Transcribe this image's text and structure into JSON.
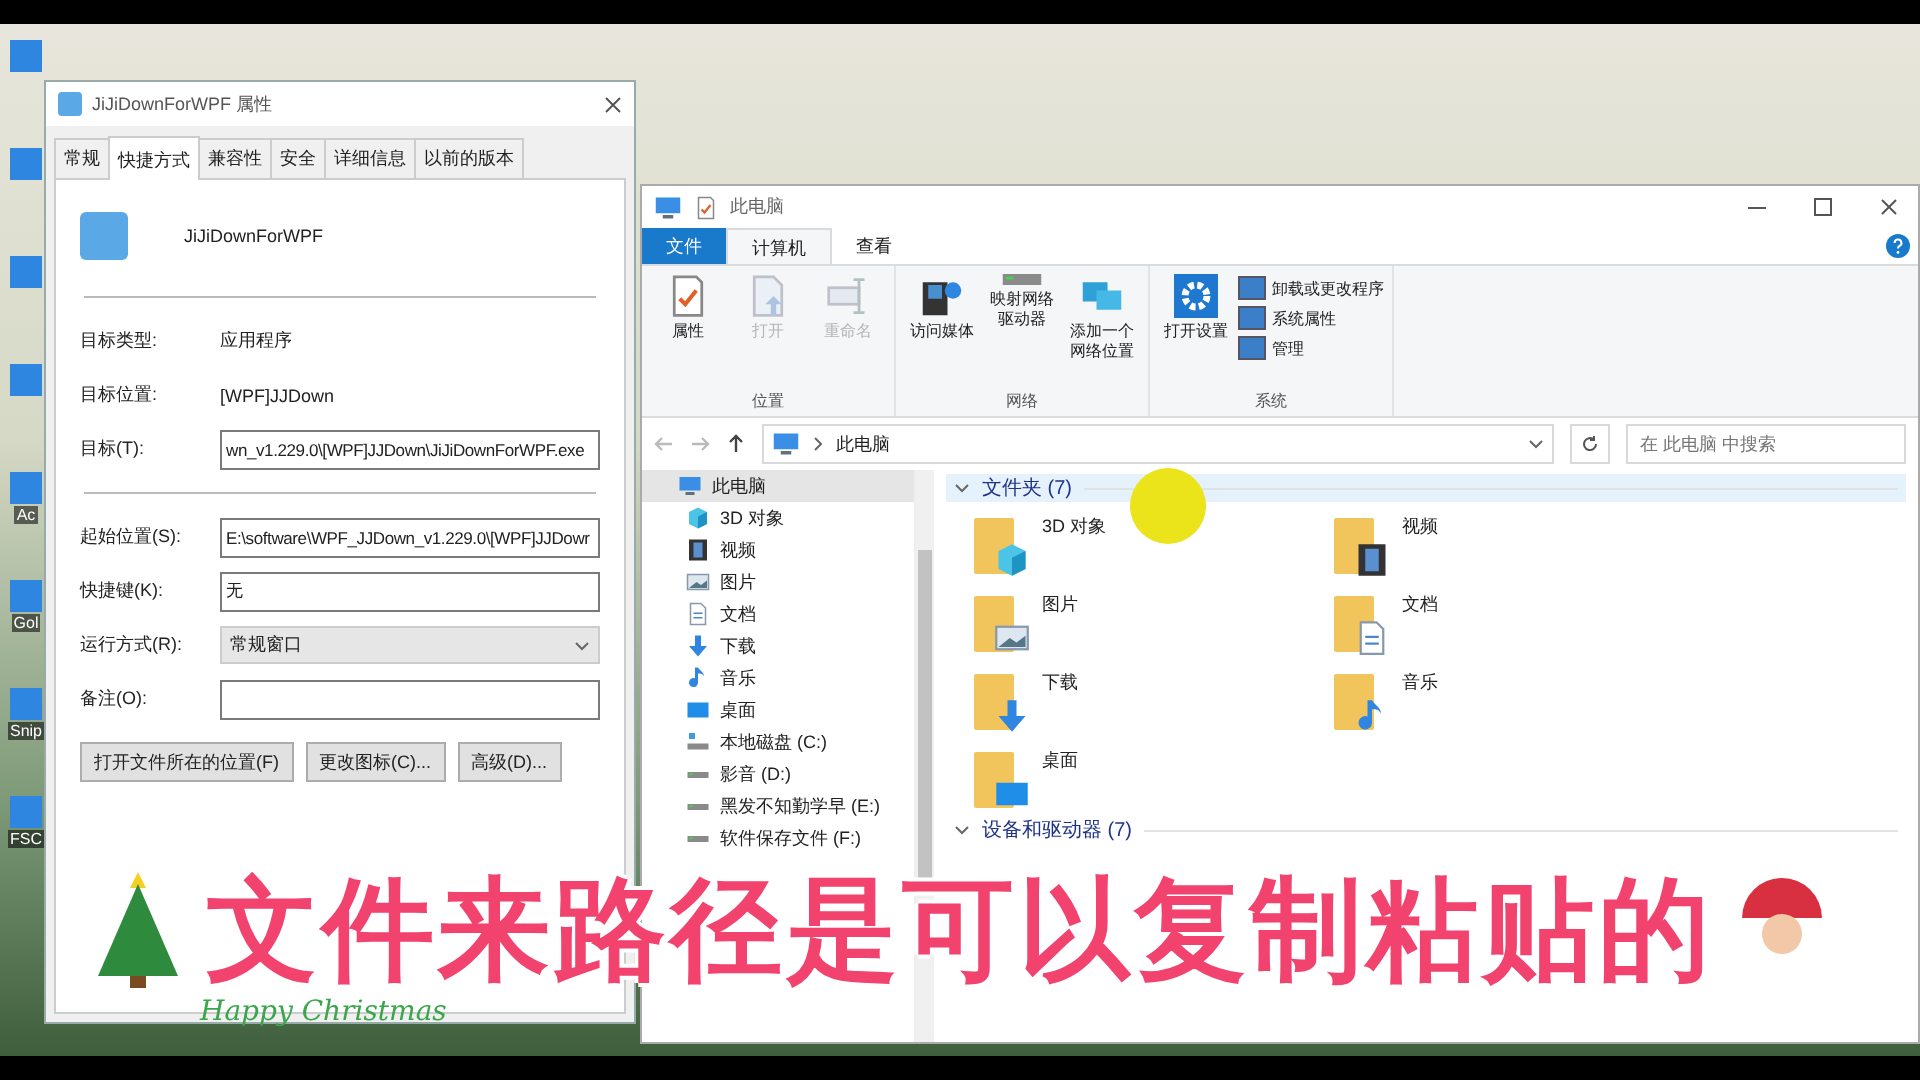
{
  "desktop_icons": [
    {
      "label": "Ac"
    },
    {
      "label": "Gol"
    },
    {
      "label": "Snip"
    },
    {
      "label": "FSC"
    }
  ],
  "properties_dialog": {
    "title": "JiJiDownForWPF 属性",
    "tabs": [
      {
        "label": "常规",
        "selected": false
      },
      {
        "label": "快捷方式",
        "selected": true
      },
      {
        "label": "兼容性",
        "selected": false
      },
      {
        "label": "安全",
        "selected": false
      },
      {
        "label": "详细信息",
        "selected": false
      },
      {
        "label": "以前的版本",
        "selected": false
      }
    ],
    "app_name": "JiJiDownForWPF",
    "info_rows": [
      {
        "label": "目标类型:",
        "value": "应用程序"
      },
      {
        "label": "目标位置:",
        "value": "[WPF]JJDown"
      }
    ],
    "fields": [
      {
        "kind": "input",
        "label": "目标(T):",
        "value": "wn_v1.229.0\\[WPF]JJDown\\JiJiDownForWPF.exe"
      },
      {
        "kind": "input",
        "label": "起始位置(S):",
        "value": "E:\\software\\WPF_JJDown_v1.229.0\\[WPF]JJDowr"
      },
      {
        "kind": "input",
        "label": "快捷键(K):",
        "value": "无"
      },
      {
        "kind": "select",
        "label": "运行方式(R):",
        "value": "常规窗口"
      },
      {
        "kind": "input",
        "label": "备注(O):"
      }
    ],
    "buttons": [
      "打开文件所在的位置(F)",
      "更改图标(C)...",
      "高级(D)..."
    ]
  },
  "explorer": {
    "title": "此电脑",
    "ribbon_tabs": [
      {
        "label": "文件",
        "kind": "file",
        "selected": false
      },
      {
        "label": "计算机",
        "kind": "tab",
        "selected": true
      },
      {
        "label": "查看",
        "kind": "tab",
        "selected": false
      }
    ],
    "ribbon_groups": [
      {
        "name": "位置",
        "buttons": [
          {
            "label": "属性",
            "kind": "props",
            "disabled": false
          },
          {
            "label": "打开",
            "kind": "open",
            "disabled": true
          },
          {
            "label": "重命名",
            "kind": "rename",
            "disabled": true
          }
        ]
      },
      {
        "name": "网络",
        "buttons": [
          {
            "label": "访问媒体",
            "kind": "media",
            "disabled": false
          },
          {
            "label": "映射网络驱动器",
            "kind": "drive",
            "disabled": false
          },
          {
            "label": "添加一个网络位置",
            "kind": "netloc",
            "disabled": false
          }
        ]
      },
      {
        "name": "系统",
        "buttons": [
          {
            "label": "打开设置",
            "kind": "settings",
            "disabled": false
          }
        ],
        "small_buttons": [
          "卸载或更改程序",
          "系统属性",
          "管理"
        ]
      }
    ],
    "address": "此电脑",
    "search": {
      "placeholder": "在 此电脑 中搜索"
    },
    "nav_items": [
      {
        "label": "此电脑",
        "kind": "pc",
        "selected": true,
        "children": [
          {
            "label": "3D 对象",
            "kind": "cube",
            "selected": false
          },
          {
            "label": "视频",
            "kind": "video",
            "selected": false
          },
          {
            "label": "图片",
            "kind": "picture",
            "selected": false
          },
          {
            "label": "文档",
            "kind": "doc",
            "selected": false
          },
          {
            "label": "下载",
            "kind": "download",
            "selected": false
          },
          {
            "label": "音乐",
            "kind": "music",
            "selected": false
          },
          {
            "label": "桌面",
            "kind": "desktop",
            "selected": false
          },
          {
            "label": "本地磁盘 (C:)",
            "kind": "sysdrive",
            "selected": false
          },
          {
            "label": "影音 (D:)",
            "kind": "drive",
            "selected": false
          },
          {
            "label": "黑发不知勤学早 (E:)",
            "kind": "drive",
            "selected": false
          },
          {
            "label": "软件保存文件 (F:)",
            "kind": "drive",
            "selected": false
          }
        ]
      }
    ],
    "sections": [
      {
        "title": "文件夹 (7)",
        "expanded": true,
        "highlighted": true,
        "items": [
          {
            "label": "3D 对象",
            "kind": "cube"
          },
          {
            "label": "视频",
            "kind": "video"
          },
          {
            "label": "图片",
            "kind": "picture"
          },
          {
            "label": "文档",
            "kind": "doc"
          },
          {
            "label": "下载",
            "kind": "download"
          },
          {
            "label": "音乐",
            "kind": "music"
          },
          {
            "label": "桌面",
            "kind": "desktop"
          }
        ]
      },
      {
        "title": "设备和驱动器 (7)",
        "expanded": true,
        "highlighted": false
      }
    ]
  },
  "subtitle": "文件来路径是可以复制粘贴的",
  "decoration_text": "Happy Christmas"
}
